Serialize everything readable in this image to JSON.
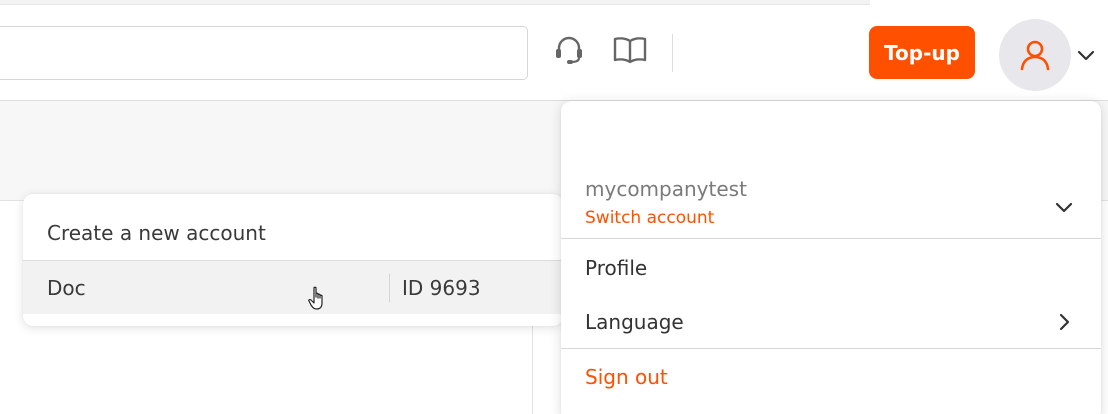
{
  "header": {
    "topup_label": "Top-up"
  },
  "account_switcher": {
    "create_label": "Create a new account",
    "accounts": [
      {
        "name": "Doc",
        "id": "ID 9693"
      }
    ]
  },
  "user_menu": {
    "username": "mycompanytest",
    "switch_label": "Switch account",
    "items": [
      {
        "label": "Profile"
      },
      {
        "label": "Language"
      }
    ],
    "signout_label": "Sign out"
  },
  "colors": {
    "accent": "#ff5000",
    "icon_gray": "#666666"
  }
}
